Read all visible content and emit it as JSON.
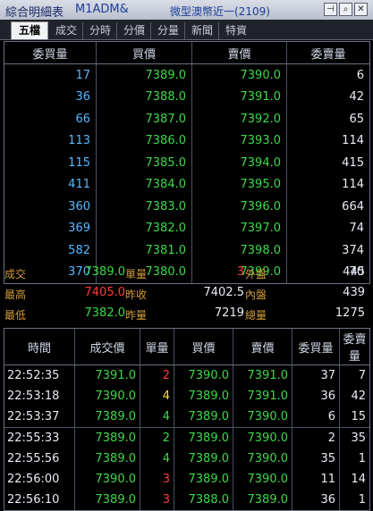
{
  "title": {
    "left": "綜合明細表",
    "code": "M1ADM&",
    "name": "微型澳幣近一(2109)"
  },
  "tabs": [
    "五檔",
    "成交",
    "分時",
    "分價",
    "分量",
    "新聞",
    "特資"
  ],
  "book_headers": [
    "委買量",
    "買價",
    "賣價",
    "委賣量"
  ],
  "book_rows": [
    [
      "17",
      "7389.0",
      "7390.0",
      "6"
    ],
    [
      "36",
      "7388.0",
      "7391.0",
      "42"
    ],
    [
      "66",
      "7387.0",
      "7392.0",
      "65"
    ],
    [
      "113",
      "7386.0",
      "7393.0",
      "114"
    ],
    [
      "115",
      "7385.0",
      "7394.0",
      "415"
    ],
    [
      "411",
      "7384.0",
      "7395.0",
      "114"
    ],
    [
      "360",
      "7383.0",
      "7396.0",
      "664"
    ],
    [
      "369",
      "7382.0",
      "7397.0",
      "74"
    ],
    [
      "582",
      "7381.0",
      "7398.0",
      "374"
    ],
    [
      "370",
      "7380.0",
      "7399.0",
      "70"
    ]
  ],
  "info": {
    "trade_label": "成交",
    "trade_value": "7389.0",
    "unit_label": "單量",
    "unit_value": "3",
    "out_label": "外盤",
    "out_value": "445",
    "high_label": "最高",
    "high_value": "7405.0",
    "prev_label": "昨收",
    "prev_value": "7402.5",
    "in_label": "內盤",
    "in_value": "439",
    "low_label": "最低",
    "low_value": "7382.0",
    "yvol_label": "昨量",
    "yvol_value": "7219",
    "total_label": "總量",
    "total_value": "1275"
  },
  "tick_headers": [
    "時間",
    "成交價",
    "單量",
    "買價",
    "賣價",
    "委買量",
    "委賣量"
  ],
  "tick_rows": [
    [
      "22:52:35",
      "7391.0",
      "2",
      "7390.0",
      "7391.0",
      "37",
      "7"
    ],
    [
      "22:53:18",
      "7390.0",
      "4",
      "7389.0",
      "7391.0",
      "36",
      "42"
    ],
    [
      "22:53:37",
      "7389.0",
      "4",
      "7389.0",
      "7390.0",
      "6",
      "15"
    ],
    [
      "22:55:33",
      "7389.0",
      "2",
      "7389.0",
      "7390.0",
      "2",
      "35"
    ],
    [
      "22:55:56",
      "7389.0",
      "4",
      "7389.0",
      "7390.0",
      "35",
      "1"
    ],
    [
      "22:56:00",
      "7390.0",
      "3",
      "7389.0",
      "7390.0",
      "11",
      "14"
    ],
    [
      "22:56:10",
      "7389.0",
      "3",
      "7388.0",
      "7389.0",
      "36",
      "1"
    ]
  ],
  "tick_unit_colors": [
    "red",
    "yellow",
    "green",
    "green",
    "green",
    "red",
    "red"
  ],
  "colors": {
    "bid_vol": "#58b8ff",
    "price_green": "#3dd94a",
    "red": "#ff3b3b",
    "yellow": "#f3e03b",
    "label": "#d09a3a"
  }
}
